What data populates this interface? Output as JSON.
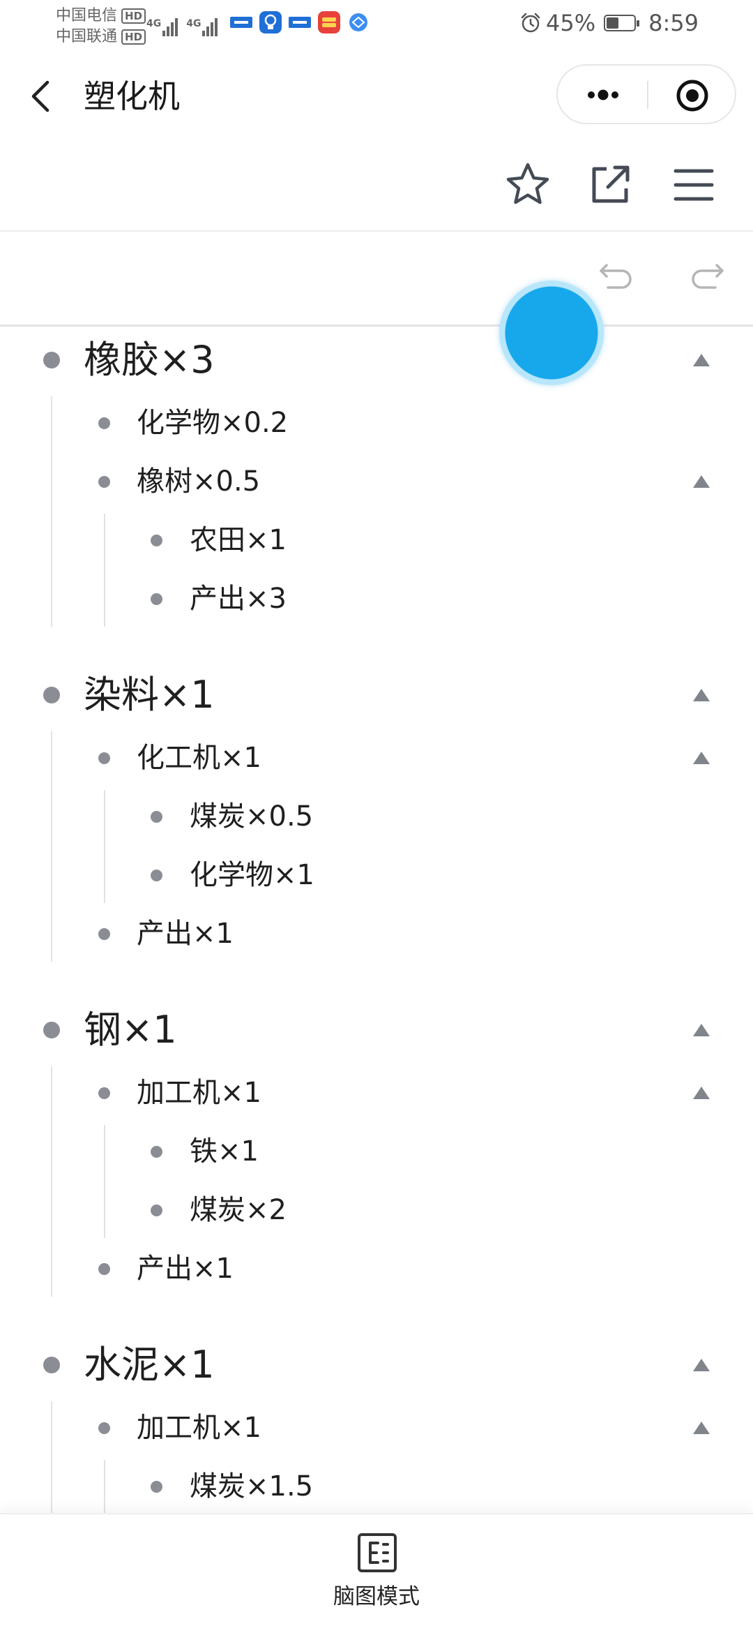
{
  "status_bar": {
    "carrier1": "中国电信",
    "carrier2": "中国联通",
    "hd": "HD",
    "network": "4G",
    "battery_text": "45%",
    "battery_level": 0.45,
    "time": "8:59"
  },
  "title_bar": {
    "title": "塑化机"
  },
  "colors": {
    "accent": "#17a8ec",
    "icon": "#444b55",
    "bullet": "#8a8d94"
  },
  "outline": {
    "nodes": [
      {
        "label": "橡胶×3",
        "level": 0,
        "collapsible": true
      },
      {
        "label": "化学物×0.2",
        "level": 1,
        "collapsible": false
      },
      {
        "label": "橡树×0.5",
        "level": 1,
        "collapsible": true
      },
      {
        "label": "农田×1",
        "level": 2,
        "collapsible": false
      },
      {
        "label": "产出×3",
        "level": 2,
        "collapsible": false
      },
      {
        "label": "染料×1",
        "level": 0,
        "collapsible": true
      },
      {
        "label": "化工机×1",
        "level": 1,
        "collapsible": true
      },
      {
        "label": "煤炭×0.5",
        "level": 2,
        "collapsible": false
      },
      {
        "label": "化学物×1",
        "level": 2,
        "collapsible": false
      },
      {
        "label": "产出×1",
        "level": 1,
        "collapsible": false
      },
      {
        "label": "钢×1",
        "level": 0,
        "collapsible": true
      },
      {
        "label": "加工机×1",
        "level": 1,
        "collapsible": true
      },
      {
        "label": "铁×1",
        "level": 2,
        "collapsible": false
      },
      {
        "label": "煤炭×2",
        "level": 2,
        "collapsible": false
      },
      {
        "label": "产出×1",
        "level": 1,
        "collapsible": false
      },
      {
        "label": "水泥×1",
        "level": 0,
        "collapsible": true
      },
      {
        "label": "加工机×1",
        "level": 1,
        "collapsible": true
      },
      {
        "label": "煤炭×1.5",
        "level": 2,
        "collapsible": false
      }
    ]
  },
  "bottom_bar": {
    "mindmap_label": "脑图模式"
  }
}
